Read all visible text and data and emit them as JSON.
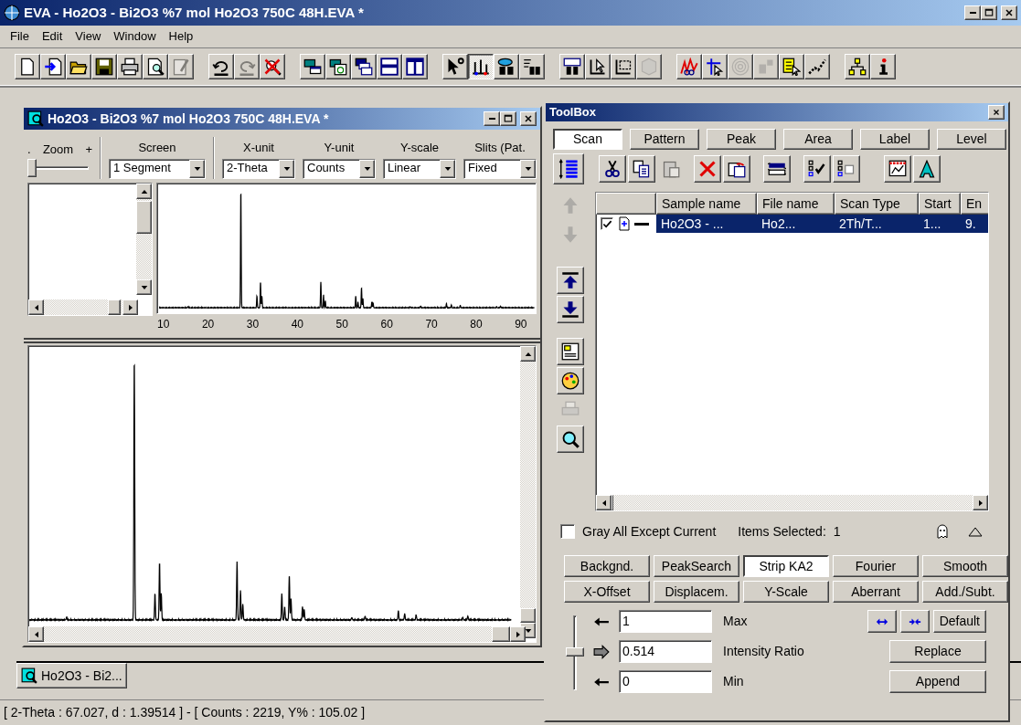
{
  "window": {
    "title": "EVA - Ho2O3 - Bi2O3 %7 mol Ho2O3 750C 48H.EVA *"
  },
  "menu": [
    {
      "label": "File"
    },
    {
      "label": "Edit"
    },
    {
      "label": "View"
    },
    {
      "label": "Window"
    },
    {
      "label": "Help"
    }
  ],
  "toolbar": [
    {
      "items": [
        {
          "disabled": false,
          "pressed": false
        },
        {
          "disabled": false,
          "pressed": false
        },
        {
          "disabled": false,
          "pressed": false
        },
        {
          "disabled": false,
          "pressed": false
        },
        {
          "disabled": false,
          "pressed": false
        },
        {
          "disabled": false,
          "pressed": false
        },
        {
          "disabled": true,
          "pressed": false
        }
      ]
    },
    {
      "items": [
        {
          "disabled": false,
          "pressed": false
        },
        {
          "disabled": true,
          "pressed": false
        },
        {
          "disabled": false,
          "pressed": false
        }
      ]
    },
    {
      "items": [
        {
          "disabled": false,
          "pressed": false
        },
        {
          "disabled": false,
          "pressed": false
        },
        {
          "disabled": false,
          "pressed": false
        },
        {
          "disabled": false,
          "pressed": false
        },
        {
          "disabled": false,
          "pressed": false
        }
      ]
    },
    {
      "items": [
        {
          "disabled": false,
          "pressed": false
        },
        {
          "disabled": false,
          "pressed": true
        },
        {
          "disabled": false,
          "pressed": false
        },
        {
          "disabled": false,
          "pressed": false
        }
      ]
    },
    {
      "items": [
        {
          "disabled": false,
          "pressed": false
        },
        {
          "disabled": false,
          "pressed": false
        },
        {
          "disabled": false,
          "pressed": false
        },
        {
          "disabled": true,
          "pressed": false
        }
      ]
    },
    {
      "items": [
        {
          "disabled": false,
          "pressed": false
        },
        {
          "disabled": false,
          "pressed": false
        },
        {
          "disabled": true,
          "pressed": false
        },
        {
          "disabled": true,
          "pressed": false
        },
        {
          "disabled": false,
          "pressed": false
        },
        {
          "disabled": false,
          "pressed": false
        }
      ]
    },
    {
      "items": [
        {
          "disabled": false,
          "pressed": false
        },
        {
          "disabled": false,
          "pressed": false
        }
      ]
    }
  ],
  "document": {
    "title": "Ho2O3 - Bi2O3 %7 mol Ho2O3 750C 48H.EVA *",
    "zoom": {
      "label": "Zoom",
      "minus": ".",
      "plus": "+",
      "level": 0
    },
    "selectors": [
      {
        "label": "Screen",
        "value": "1 Segment"
      },
      {
        "label": "X-unit",
        "value": "2-Theta"
      },
      {
        "label": "Y-unit",
        "value": "Counts"
      },
      {
        "label": "Y-scale",
        "value": "Linear"
      },
      {
        "label": "Slits (Pat.",
        "value": "Fixed"
      }
    ],
    "x_tick_labels": [
      "10",
      "20",
      "30",
      "40",
      "50",
      "60",
      "70",
      "80",
      "90"
    ]
  },
  "document_tab": {
    "label": "Ho2O3 - Bi2..."
  },
  "status_bar": {
    "text": "[ 2-Theta : 67.027, d : 1.39514 ] - [ Counts : 2219, Y% : 105.02 ]"
  },
  "toolbox": {
    "title": "ToolBox",
    "tabs": [
      {
        "label": "Scan",
        "selected": true
      },
      {
        "label": "Pattern",
        "selected": false
      },
      {
        "label": "Peak",
        "selected": false
      },
      {
        "label": "Area",
        "selected": false
      },
      {
        "label": "Label",
        "selected": false
      },
      {
        "label": "Level",
        "selected": false
      }
    ],
    "tools": [
      {
        "disabled": false
      },
      {
        "disabled": false
      },
      {
        "disabled": false
      },
      {
        "disabled": true
      },
      {
        "disabled": false
      },
      {
        "disabled": false
      },
      {
        "disabled": false
      },
      {
        "disabled": false
      },
      {
        "disabled": false
      },
      {
        "disabled": false
      },
      {
        "disabled": false
      }
    ],
    "side_tools": [
      {
        "disabled": true
      },
      {
        "disabled": true
      },
      {
        "disabled": false
      },
      {
        "disabled": false
      },
      {
        "disabled": false
      },
      {
        "disabled": false
      },
      {
        "disabled": true
      },
      {
        "disabled": false
      }
    ],
    "table": {
      "columns": [
        "Sample name",
        "File name",
        "Scan Type",
        "Start",
        "En"
      ],
      "rows": [
        {
          "checked": true,
          "selected": true,
          "cells": [
            "Ho2O3 - ...",
            "Ho2...",
            "2Th/T...",
            "1...",
            "9."
          ]
        }
      ]
    },
    "gray_all": {
      "label": "Gray All Except Current",
      "checked": false
    },
    "items_selected": {
      "label": "Items Selected:",
      "value": "1"
    },
    "operations": [
      {
        "label": "Backgnd.",
        "selected": false
      },
      {
        "label": "PeakSearch",
        "selected": false
      },
      {
        "label": "Strip KA2",
        "selected": true
      },
      {
        "label": "Fourier",
        "selected": false
      },
      {
        "label": "Smooth",
        "selected": false
      },
      {
        "label": "X-Offset",
        "selected": false
      },
      {
        "label": "Displacem.",
        "selected": false
      },
      {
        "label": "Y-Scale",
        "selected": false
      },
      {
        "label": "Aberrant",
        "selected": false
      },
      {
        "label": "Add./Subt.",
        "selected": false
      }
    ],
    "intensity": {
      "level": 0.5,
      "fields": [
        {
          "value": "1",
          "label": "Max"
        },
        {
          "value": "0.514",
          "label": "Intensity Ratio"
        },
        {
          "value": "0",
          "label": "Min"
        }
      ]
    },
    "buttons": [
      {
        "label": "Default"
      },
      {
        "label": "Replace"
      },
      {
        "label": "Append"
      }
    ]
  }
}
